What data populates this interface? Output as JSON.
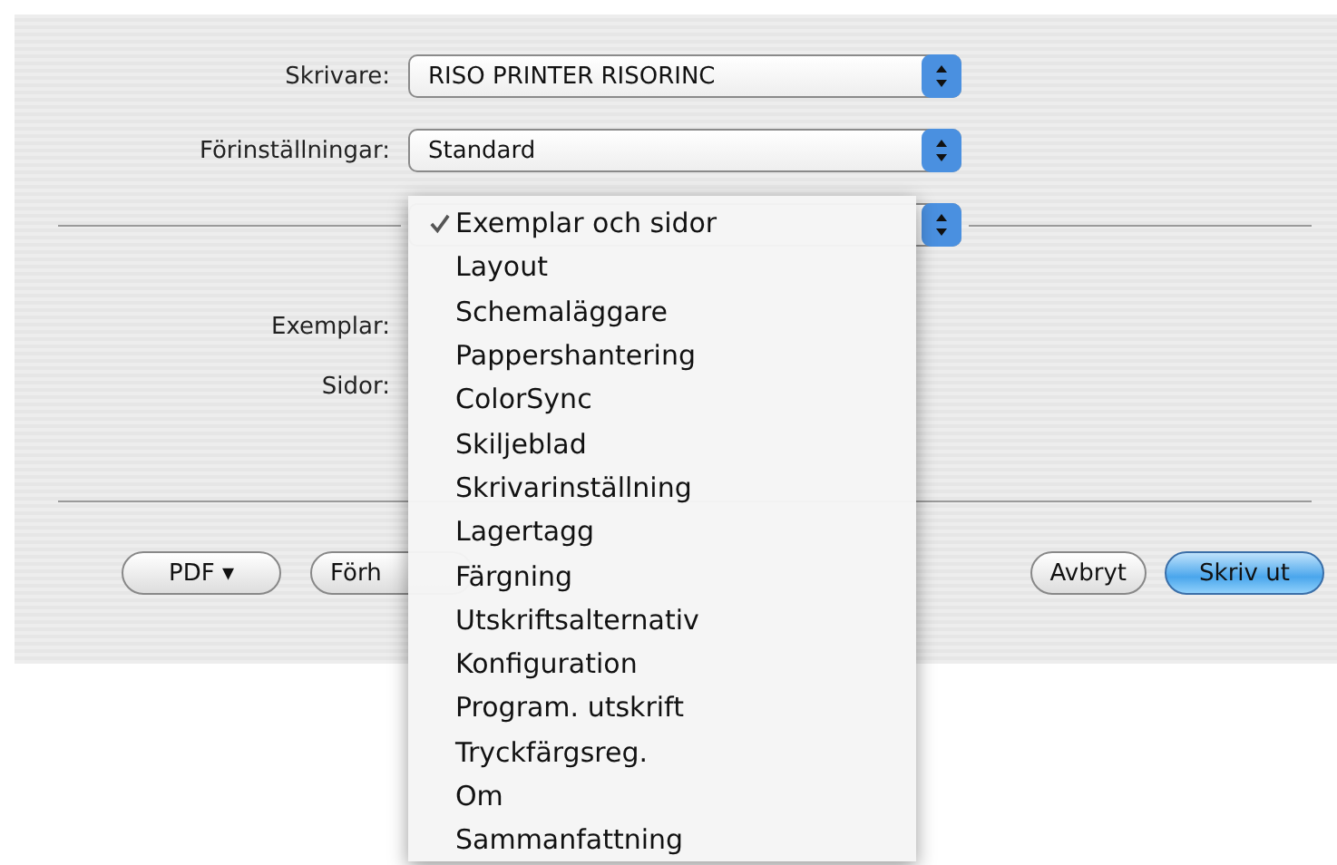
{
  "printer": {
    "label": "Skrivare:",
    "value": "RISO PRINTER RISORINC"
  },
  "presets": {
    "label": "Förinställningar:",
    "value": "Standard"
  },
  "copies": {
    "label": "Exemplar:"
  },
  "pages": {
    "label": "Sidor:"
  },
  "menu": [
    {
      "label": "Exemplar och sidor",
      "checked": true
    },
    {
      "label": "Layout",
      "checked": false
    },
    {
      "label": "Schemaläggare",
      "checked": false
    },
    {
      "label": "Pappershantering",
      "checked": false
    },
    {
      "label": "ColorSync",
      "checked": false
    },
    {
      "label": "Skiljeblad",
      "checked": false
    },
    {
      "label": "Skrivarinställning",
      "checked": false
    },
    {
      "label": "Lagertagg",
      "checked": false
    },
    {
      "label": "Färgning",
      "checked": false
    },
    {
      "label": "Utskriftsalternativ",
      "checked": false
    },
    {
      "label": "Konfiguration",
      "checked": false
    },
    {
      "label": "Program. utskrift",
      "checked": false
    },
    {
      "label": "Tryckfärgsreg.",
      "checked": false
    },
    {
      "label": "Om",
      "checked": false
    },
    {
      "label": "Sammanfattning",
      "checked": false
    }
  ],
  "buttons": {
    "pdf": "PDF ▾",
    "preview": "Förh",
    "cancel": "Avbryt",
    "print": "Skriv ut"
  }
}
